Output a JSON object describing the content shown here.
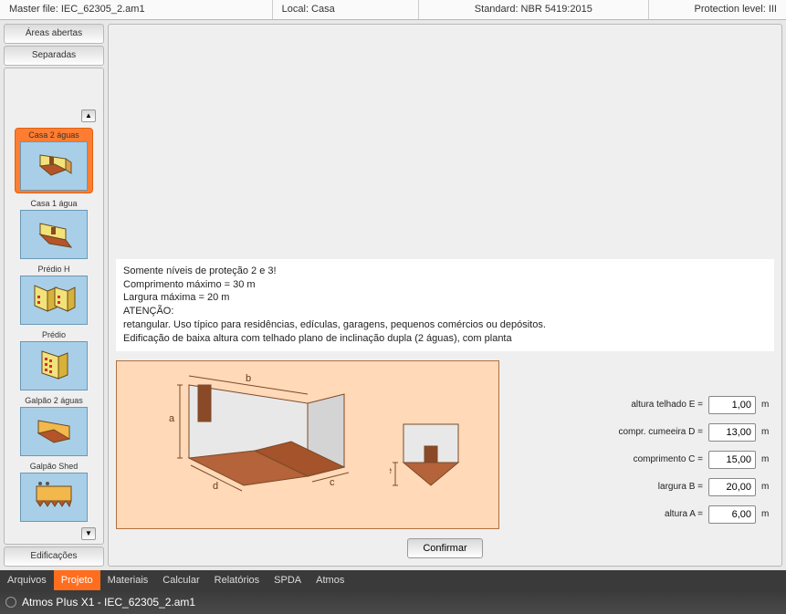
{
  "window": {
    "title": "Atmos PIus X1 - IEC_62305_2.am1"
  },
  "menu": {
    "arquivos": "Arquivos",
    "projeto": "Projeto",
    "materiais": "Materiais",
    "calcular": "Calcular",
    "relatorios": "Relatórios",
    "spda": "SPDA",
    "atmos": "Atmos"
  },
  "sidebar": {
    "header_edificacoes": "Edificações",
    "header_separadas": "Separadas",
    "header_areas_abertas": "Áreas abertas",
    "items": [
      {
        "label": "Galpão Shed"
      },
      {
        "label": "Galpão 2 águas"
      },
      {
        "label": "Prédio"
      },
      {
        "label": "Prédio H"
      },
      {
        "label": "Casa 1 água"
      },
      {
        "label": "Casa 2 águas"
      }
    ]
  },
  "confirm_label": "Confirmar",
  "fields": {
    "altura_a": {
      "label": "altura A =",
      "value": "6,00",
      "unit": "m"
    },
    "largura_b": {
      "label": "largura B =",
      "value": "20,00",
      "unit": "m"
    },
    "comprimento_c": {
      "label": "comprimento C =",
      "value": "15,00",
      "unit": "m"
    },
    "cumeeira_d": {
      "label": "compr. cumeeira D =",
      "value": "13,00",
      "unit": "m"
    },
    "telhado_e": {
      "label": "altura telhado E =",
      "value": "1,00",
      "unit": "m"
    }
  },
  "diagram_labels": {
    "a": "a",
    "b": "b",
    "c": "c",
    "d": "d",
    "e": "e"
  },
  "description": {
    "l1": "Edificação de baixa altura com telhado plano de inclinação dupla (2 águas), com planta",
    "l2": "retangular. Uso típico para residências, edículas, garagens, pequenos comércios ou depósitos.",
    "l3": "ATENÇÃO:",
    "l4": "Largura máxima = 20 m",
    "l5": "Comprimento máximo = 30 m",
    "l6": "Somente níveis de proteção 2 e 3!"
  },
  "status": {
    "master": "Master file: IEC_62305_2.am1",
    "local": "Local: Casa",
    "standard": "Standard: NBR 5419:2015",
    "protection": "Protection level: III"
  }
}
